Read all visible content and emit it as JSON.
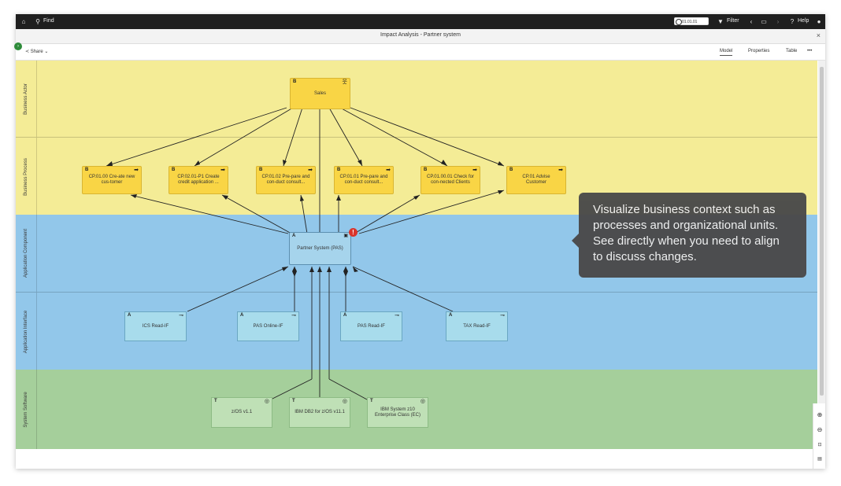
{
  "topbar": {
    "find_label": "Find",
    "date_value": "01.01.01",
    "filter_label": "Filter",
    "help_label": "Help"
  },
  "window": {
    "title": "Impact Analysis - Partner system",
    "close": "×"
  },
  "toolbar": {
    "share_label": "Share",
    "tabs": [
      "Model",
      "Properties",
      "Table"
    ],
    "active_tab": "Model",
    "more": "•••"
  },
  "lanes": [
    {
      "label": "Business Actor",
      "color": "#f4ec96"
    },
    {
      "label": "Business Process",
      "color": "#f4ec96"
    },
    {
      "label": "Application Component",
      "color": "#92c7ea"
    },
    {
      "label": "Application Interface",
      "color": "#92c7ea"
    },
    {
      "label": "System Software",
      "color": "#a5cf9b"
    }
  ],
  "nodes": {
    "sales": {
      "tag": "B",
      "label": "Sales",
      "icon": "actor-icon"
    },
    "cp0100": {
      "tag": "B",
      "label": "CP.01.00 Cre-ate new cus-tomer",
      "icon": "arrow-icon"
    },
    "cp0201": {
      "tag": "B",
      "label": "CP.02.01-P1 Create credit application ...",
      "icon": "arrow-icon"
    },
    "cp0102": {
      "tag": "B",
      "label": "CP.01.02 Pre-pare and con-duct consult...",
      "icon": "arrow-icon"
    },
    "cp0101": {
      "tag": "B",
      "label": "CP.01.01 Pre-pare and con-duct consult...",
      "icon": "arrow-icon"
    },
    "cp01001": {
      "tag": "B",
      "label": "CP.01.00.01 Check for con-nected Clients",
      "icon": "arrow-icon"
    },
    "cp01adv": {
      "tag": "B",
      "label": "CP.01 Advise Customer",
      "icon": "arrow-icon"
    },
    "pas": {
      "tag": "A",
      "label": "Partner System (PAS)",
      "icon": "component-icon"
    },
    "ics": {
      "tag": "A",
      "label": "ICS Read-IF",
      "icon": "interface-icon"
    },
    "pasonline": {
      "tag": "A",
      "label": "PAS Online-IF",
      "icon": "interface-icon"
    },
    "pasread": {
      "tag": "A",
      "label": "PAS Read-IF",
      "icon": "interface-icon"
    },
    "tax": {
      "tag": "A",
      "label": "TAX Read-IF",
      "icon": "interface-icon"
    },
    "zos": {
      "tag": "T",
      "label": "z/OS v1.1",
      "icon": "system-software-icon"
    },
    "db2": {
      "tag": "T",
      "label": "IBM DB2 for z/OS v11.1",
      "icon": "system-software-icon"
    },
    "z10": {
      "tag": "T",
      "label": "IBM System z10 Enterprise Class (EC)",
      "icon": "system-software-icon"
    }
  },
  "tooltip": {
    "text": "Visualize business context such as processes and organizational units. See directly when you need to align to discuss changes."
  }
}
